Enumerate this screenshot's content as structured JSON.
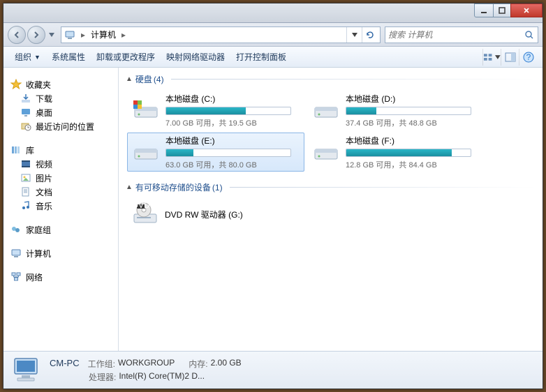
{
  "addressbar": {
    "root_label": "计算机",
    "search_placeholder": "搜索 计算机"
  },
  "toolbar": {
    "organize": "组织",
    "system_props": "系统属性",
    "uninstall": "卸载或更改程序",
    "map_drive": "映射网络驱动器",
    "control_panel": "打开控制面板"
  },
  "sidebar": {
    "favorites": {
      "label": "收藏夹",
      "downloads": "下载",
      "desktop": "桌面",
      "recent": "最近访问的位置"
    },
    "libraries": {
      "label": "库",
      "videos": "视频",
      "pictures": "图片",
      "documents": "文档",
      "music": "音乐"
    },
    "homegroup": "家庭组",
    "computer": "计算机",
    "network": "网络"
  },
  "groups": {
    "drives": {
      "name": "硬盘",
      "count": "(4)"
    },
    "removable": {
      "name": "有可移动存储的设备",
      "count": "(1)"
    }
  },
  "drives": {
    "c": {
      "name": "本地磁盘 (C:)",
      "text": "7.00 GB 可用，共 19.5 GB",
      "fill": 64
    },
    "d": {
      "name": "本地磁盘 (D:)",
      "text": "37.4 GB 可用，共 48.8 GB",
      "fill": 24
    },
    "e": {
      "name": "本地磁盘 (E:)",
      "text": "63.0 GB 可用，共 80.0 GB",
      "fill": 22
    },
    "f": {
      "name": "本地磁盘 (F:)",
      "text": "12.8 GB 可用，共 84.4 GB",
      "fill": 85
    }
  },
  "optical": {
    "name": "DVD RW 驱动器 (G:)"
  },
  "status": {
    "name": "CM-PC",
    "workgroup_label": "工作组:",
    "workgroup": "WORKGROUP",
    "memory_label": "内存:",
    "memory": "2.00 GB",
    "cpu_label": "处理器:",
    "cpu": "Intel(R) Core(TM)2 D..."
  }
}
